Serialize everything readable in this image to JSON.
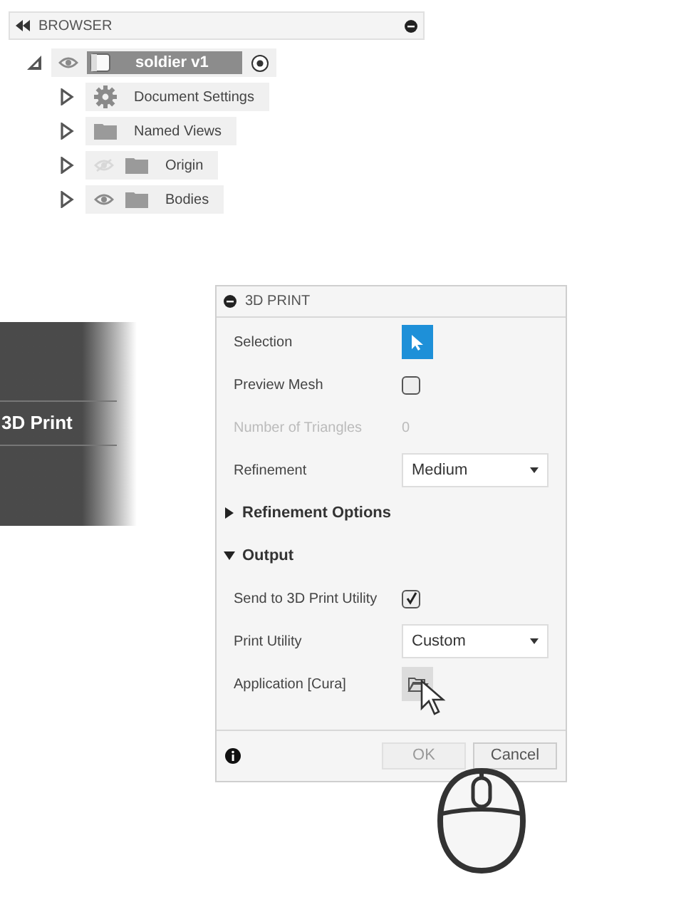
{
  "browser": {
    "title": "BROWSER",
    "tree": [
      {
        "kind": "component",
        "label": "soldier v1",
        "expanded": true,
        "visible": true,
        "children": [
          {
            "kind": "settings",
            "label": "Document Settings",
            "expanded": false
          },
          {
            "kind": "folder",
            "label": "Named Views",
            "expanded": false
          },
          {
            "kind": "folder",
            "label": "Origin",
            "expanded": false,
            "visible": false
          },
          {
            "kind": "folder",
            "label": "Bodies",
            "expanded": false,
            "visible": true
          }
        ]
      }
    ]
  },
  "side_menu": {
    "items": [
      {
        "label": "3D Print"
      }
    ]
  },
  "dialog": {
    "title": "3D PRINT",
    "rows": [
      {
        "kind": "selection",
        "label": "Selection",
        "selected": true
      },
      {
        "kind": "checkbox",
        "label": "Preview Mesh",
        "checked": false
      },
      {
        "kind": "readout",
        "label": "Number of Triangles",
        "value": "0",
        "disabled": true
      },
      {
        "kind": "dropdown",
        "label": "Refinement",
        "value": "Medium"
      },
      {
        "kind": "section",
        "label": "Refinement Options",
        "expanded": false
      },
      {
        "kind": "section",
        "label": "Output",
        "expanded": true
      },
      {
        "kind": "checkbox",
        "label": "Send to 3D Print Utility",
        "checked": true
      },
      {
        "kind": "dropdown",
        "label": "Print Utility",
        "value": "Custom"
      },
      {
        "kind": "file",
        "label": "Application [Cura]"
      }
    ],
    "buttons": [
      {
        "label": "OK",
        "disabled": true
      },
      {
        "label": "Cancel",
        "disabled": false
      }
    ]
  }
}
